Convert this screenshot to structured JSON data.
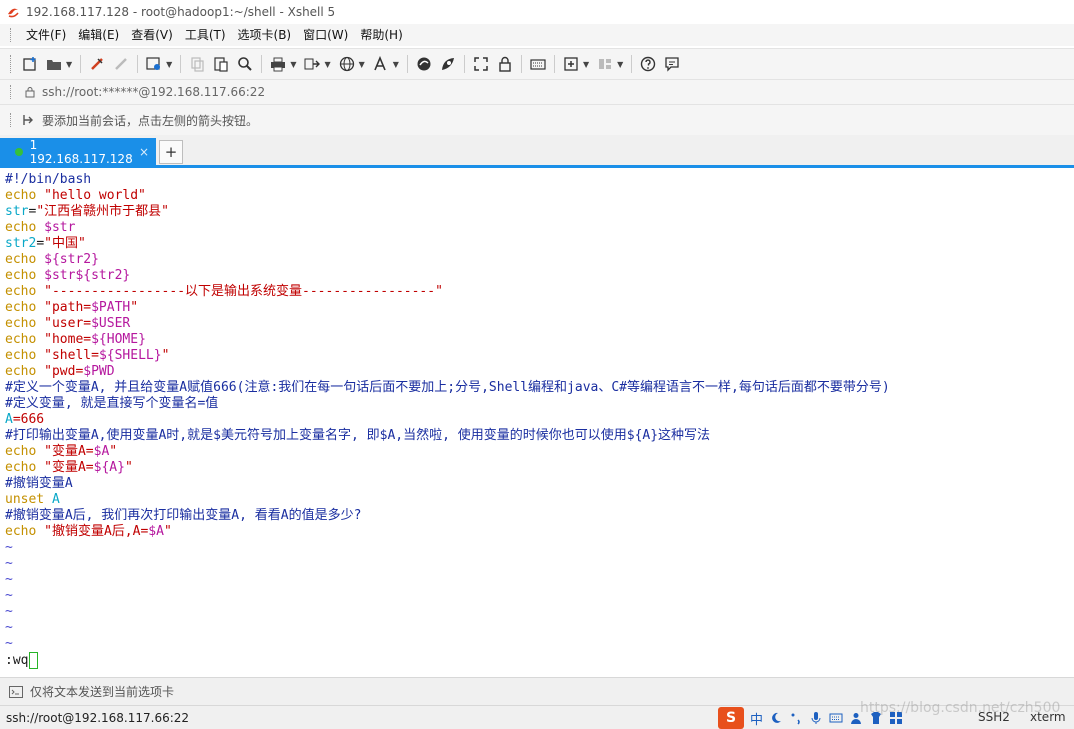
{
  "window": {
    "title": "192.168.117.128 - root@hadoop1:~/shell - Xshell 5"
  },
  "menu": {
    "items": [
      "文件(F)",
      "编辑(E)",
      "查看(V)",
      "工具(T)",
      "选项卡(B)",
      "窗口(W)",
      "帮助(H)"
    ]
  },
  "toolbar": {
    "icons": [
      "new-session-icon",
      "open-folder-icon",
      "link-icon",
      "unlink-icon",
      "properties-icon",
      "copy-icon",
      "paste-icon",
      "find-icon",
      "print-icon",
      "transfer-icon",
      "globe-icon",
      "font-icon",
      "xftp-icon",
      "xmanager-icon",
      "fullscreen-icon",
      "lock-icon",
      "keyboard-icon",
      "new-tab-icon",
      "layout-icon",
      "help-icon",
      "chat-icon"
    ]
  },
  "address": {
    "value": "ssh://root:******@192.168.117.66:22"
  },
  "hint": {
    "text": "要添加当前会话，点击左侧的箭头按钮。"
  },
  "tabs": {
    "active_label": "1 192.168.117.128",
    "close_symbol": "×",
    "add_symbol": "+"
  },
  "terminal": {
    "lines": [
      [
        {
          "t": "#!/bin/bash",
          "c": "shebang"
        }
      ],
      [
        {
          "t": "echo ",
          "c": "kw"
        },
        {
          "t": "\"hello world\"",
          "c": "str"
        }
      ],
      [
        {
          "t": "str",
          "c": "assign"
        },
        {
          "t": "=",
          "c": "default"
        },
        {
          "t": "\"江西省赣州市于都县\"",
          "c": "str"
        }
      ],
      [
        {
          "t": "echo ",
          "c": "kw"
        },
        {
          "t": "$str",
          "c": "var"
        }
      ],
      [
        {
          "t": "str2",
          "c": "assign"
        },
        {
          "t": "=",
          "c": "default"
        },
        {
          "t": "\"中国\"",
          "c": "str"
        }
      ],
      [
        {
          "t": "echo ",
          "c": "kw"
        },
        {
          "t": "${str2}",
          "c": "var"
        }
      ],
      [
        {
          "t": "echo ",
          "c": "kw"
        },
        {
          "t": "$str${str2}",
          "c": "var"
        }
      ],
      [
        {
          "t": "echo ",
          "c": "kw"
        },
        {
          "t": "\"-----------------以下是输出系统变量-----------------\"",
          "c": "str"
        }
      ],
      [
        {
          "t": "echo ",
          "c": "kw"
        },
        {
          "t": "\"path=",
          "c": "str"
        },
        {
          "t": "$PATH",
          "c": "var"
        },
        {
          "t": "\"",
          "c": "str"
        }
      ],
      [
        {
          "t": "echo ",
          "c": "kw"
        },
        {
          "t": "\"user=",
          "c": "str"
        },
        {
          "t": "$USER",
          "c": "var"
        }
      ],
      [
        {
          "t": "echo ",
          "c": "kw"
        },
        {
          "t": "\"home=",
          "c": "str"
        },
        {
          "t": "${HOME}",
          "c": "var"
        }
      ],
      [
        {
          "t": "echo ",
          "c": "kw"
        },
        {
          "t": "\"shell=",
          "c": "str"
        },
        {
          "t": "${SHELL}",
          "c": "var"
        },
        {
          "t": "\"",
          "c": "str"
        }
      ],
      [
        {
          "t": "echo ",
          "c": "kw"
        },
        {
          "t": "\"pwd=",
          "c": "str"
        },
        {
          "t": "$PWD",
          "c": "var"
        }
      ],
      [
        {
          "t": "#定义一个变量A, 并且给变量A赋值666(注意:我们在每一句话后面不要加上;分号,Shell编程和java、C#等编程语言不一样,每句话后面都不要带分号)",
          "c": "comment"
        }
      ],
      [
        {
          "t": "#定义变量, 就是直接写个变量名=值",
          "c": "comment"
        }
      ],
      [
        {
          "t": "A",
          "c": "assign"
        },
        {
          "t": "=666",
          "c": "str"
        }
      ],
      [
        {
          "t": "#打印输出变量A,使用变量A时,就是$美元符号加上变量名字, 即$A,当然啦, 使用变量的时候你也可以使用${A}这种写法",
          "c": "comment"
        }
      ],
      [
        {
          "t": "echo ",
          "c": "kw"
        },
        {
          "t": "\"变量A=",
          "c": "str"
        },
        {
          "t": "$A",
          "c": "var"
        },
        {
          "t": "\"",
          "c": "str"
        }
      ],
      [
        {
          "t": "echo ",
          "c": "kw"
        },
        {
          "t": "\"变量A=",
          "c": "str"
        },
        {
          "t": "${A}",
          "c": "var"
        },
        {
          "t": "\"",
          "c": "str"
        }
      ],
      [
        {
          "t": "#撤销变量A",
          "c": "comment"
        }
      ],
      [
        {
          "t": "unset ",
          "c": "kw"
        },
        {
          "t": "A",
          "c": "assign"
        }
      ],
      [
        {
          "t": "#撤销变量A后, 我们再次打印输出变量A, 看看A的值是多少?",
          "c": "comment"
        }
      ],
      [
        {
          "t": "echo ",
          "c": "kw"
        },
        {
          "t": "\"撤销变量A后,A=",
          "c": "str"
        },
        {
          "t": "$A",
          "c": "var"
        },
        {
          "t": "\"",
          "c": "str"
        }
      ],
      [
        {
          "t": "~",
          "c": "tilde"
        }
      ],
      [
        {
          "t": "~",
          "c": "tilde"
        }
      ],
      [
        {
          "t": "~",
          "c": "tilde"
        }
      ],
      [
        {
          "t": "~",
          "c": "tilde"
        }
      ],
      [
        {
          "t": "~",
          "c": "tilde"
        }
      ],
      [
        {
          "t": "~",
          "c": "tilde"
        }
      ],
      [
        {
          "t": "~",
          "c": "tilde"
        }
      ]
    ],
    "command": ":wq"
  },
  "sendbar": {
    "text": "仅将文本发送到当前选项卡"
  },
  "status": {
    "connection": "ssh://root@192.168.117.66:22",
    "ime_lang": "中",
    "protocol": "SSH2",
    "terminal_type": "xterm",
    "ime_logo": "S"
  },
  "watermark": {
    "text": "https://blog.csdn.net/czh500"
  }
}
